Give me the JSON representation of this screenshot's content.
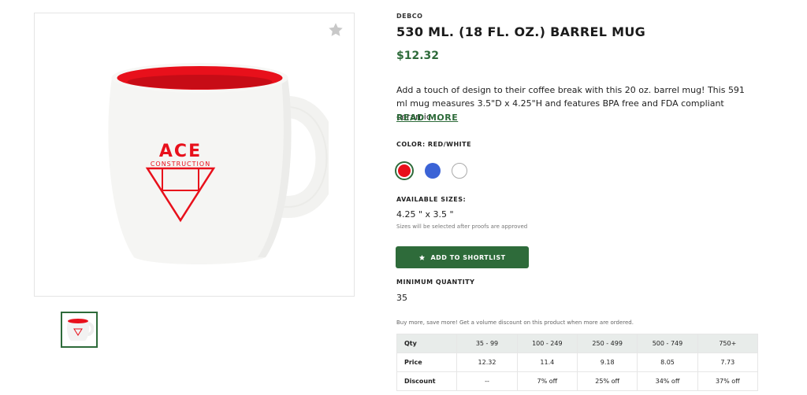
{
  "product": {
    "brand": "DEBCO",
    "title": "530 ML. (18 FL. OZ.) BARREL MUG",
    "price": "$12.32",
    "description": "Add a touch of design to their coffee break with this 20 oz. barrel mug! This 591 ml mug measures 3.5\"D x 4.25\"H and features BPA free and FDA compliant ceramic...",
    "read_more": "READ MORE",
    "image_print": {
      "line1": "ACE",
      "line2": "CONSTRUCTION"
    }
  },
  "color": {
    "label": "COLOR: RED/WHITE",
    "swatches": [
      {
        "name": "red",
        "hex": "#e8101b",
        "selected": true
      },
      {
        "name": "blue",
        "hex": "#3b63d6",
        "selected": false
      },
      {
        "name": "white",
        "hex": "#ffffff",
        "selected": false
      }
    ]
  },
  "sizes": {
    "label": "AVAILABLE SIZES:",
    "value": "4.25 \" x 3.5 \"",
    "note": "Sizes will be selected after proofs are approved"
  },
  "shortlist_button": {
    "label": "ADD TO SHORTLIST",
    "icon": "star-icon"
  },
  "favorite_icon": "star-icon",
  "min_quantity": {
    "label": "MINIMUM QUANTITY",
    "value": "35"
  },
  "volume_note": "Buy more, save more! Get a volume discount on this product when more are ordered.",
  "pricing_table": {
    "headers": [
      "Qty",
      "35 - 99",
      "100 - 249",
      "250 - 499",
      "500 - 749",
      "750+"
    ],
    "rows": [
      [
        "Price",
        "12.32",
        "11.4",
        "9.18",
        "8.05",
        "7.73"
      ],
      [
        "Discount",
        "--",
        "7% off",
        "25% off",
        "34% off",
        "37% off"
      ]
    ]
  },
  "colors": {
    "accent": "#2e6b3a",
    "mug_red": "#e8101b"
  }
}
